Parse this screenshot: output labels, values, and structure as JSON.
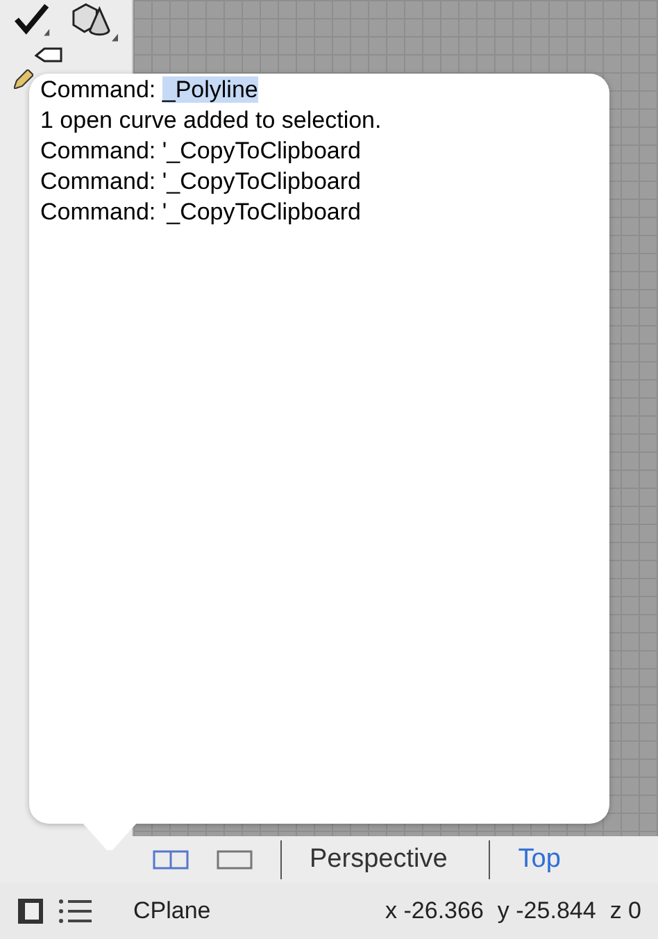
{
  "command_history": {
    "lines": [
      {
        "prefix": "Command: ",
        "highlight": "_Polyline"
      },
      {
        "prefix": "1 open curve added to selection."
      },
      {
        "prefix": "Command: '_CopyToClipboard"
      },
      {
        "prefix": "Command: '_CopyToClipboard"
      },
      {
        "prefix": "Command: '_CopyToClipboard"
      }
    ]
  },
  "viewport_tabs": [
    {
      "label": "Perspective",
      "selected": false
    },
    {
      "label": "Top",
      "selected": true
    }
  ],
  "status_bar": {
    "cplane": "CPlane",
    "x": "x -26.366",
    "y": "y -25.844",
    "z": "z 0"
  }
}
